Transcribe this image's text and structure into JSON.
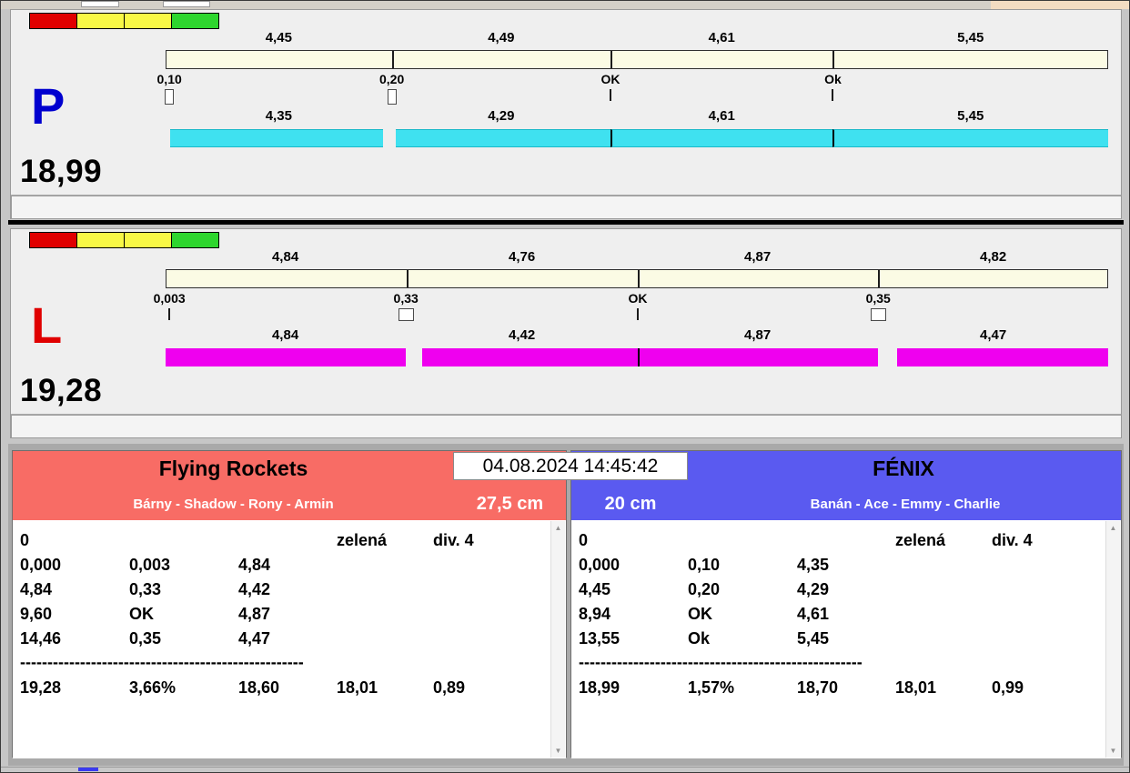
{
  "colors": {
    "lane_p_letter": "#0000cf",
    "lane_l_letter": "#e00000",
    "bar_top": "#fbfbe4",
    "bar_p": "#3fe1f0",
    "bar_l": "#ef00ef",
    "team_left_header": "#f86c65",
    "team_right_header": "#5a5af0",
    "indicator": [
      "#e00000",
      "#f8f846",
      "#f8f846",
      "#2ed62e"
    ]
  },
  "panels": {
    "p": {
      "letter": "P",
      "total": "18,99",
      "top_values": [
        "4,45",
        "4,49",
        "4,61",
        "5,45"
      ],
      "markers": [
        "0,10",
        "0,20",
        "OK",
        "Ok"
      ],
      "bottom_values": [
        "4,35",
        "4,29",
        "4,61",
        "5,45"
      ]
    },
    "l": {
      "letter": "L",
      "total": "19,28",
      "top_values": [
        "4,84",
        "4,76",
        "4,87",
        "4,82"
      ],
      "markers": [
        "0,003",
        "0,33",
        "OK",
        "0,35"
      ],
      "bottom_values": [
        "4,84",
        "4,42",
        "4,87",
        "4,47"
      ]
    }
  },
  "footer": {
    "timestamp": "04.08.2024 14:45:42",
    "left": {
      "team": "Flying Rockets",
      "dogs": "Bárny - Shadow - Rony - Armin",
      "height": "27,5 cm",
      "table": {
        "status": "0",
        "color_label": "zelená",
        "division": "div. 4",
        "rows": [
          [
            "0,000",
            "0,003",
            "4,84"
          ],
          [
            "4,84",
            "0,33",
            "4,42"
          ],
          [
            "9,60",
            "OK",
            "4,87"
          ],
          [
            "14,46",
            "0,35",
            "4,47"
          ]
        ],
        "separator": "----------------------------------------------------",
        "totals": [
          "19,28",
          "3,66%",
          "18,60",
          "18,01",
          "0,89"
        ]
      }
    },
    "right": {
      "team": "FÉNIX",
      "dogs": "Banán - Ace - Emmy - Charlie",
      "height": "20 cm",
      "table": {
        "status": "0",
        "color_label": "zelená",
        "division": "div. 4",
        "rows": [
          [
            "0,000",
            "0,10",
            "4,35"
          ],
          [
            "4,45",
            "0,20",
            "4,29"
          ],
          [
            "8,94",
            "OK",
            "4,61"
          ],
          [
            "13,55",
            "Ok",
            "5,45"
          ]
        ],
        "separator": "----------------------------------------------------",
        "totals": [
          "18,99",
          "1,57%",
          "18,70",
          "18,01",
          "0,99"
        ]
      }
    }
  },
  "scrollbar": {
    "up": "▲",
    "down": "▼"
  }
}
